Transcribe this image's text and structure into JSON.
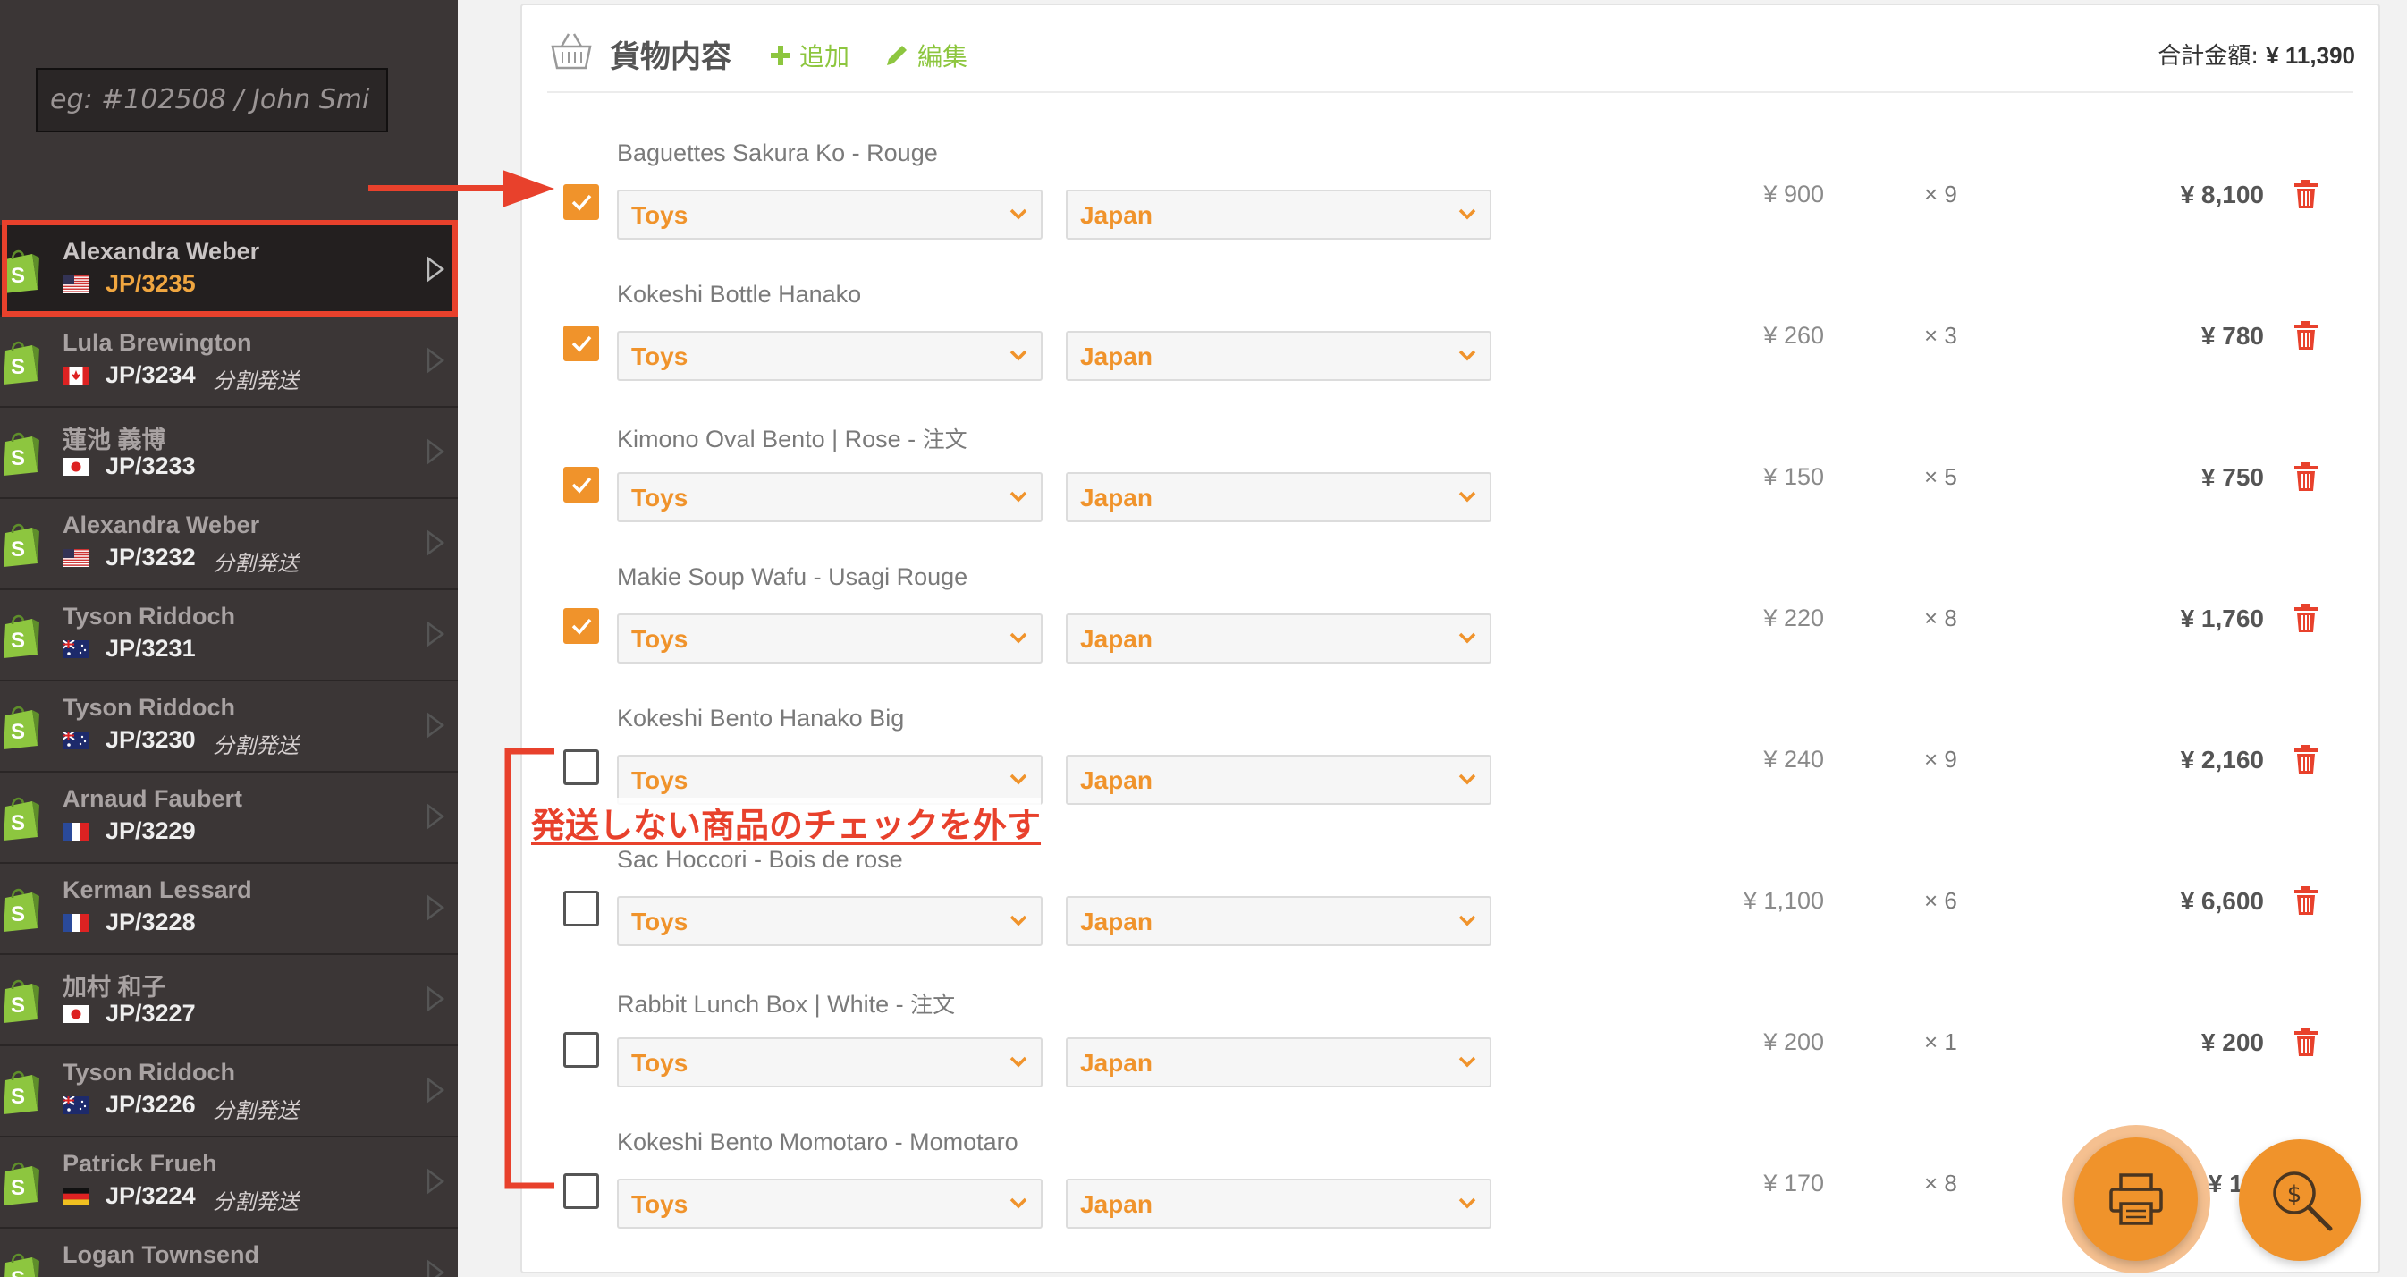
{
  "sidebar": {
    "search_placeholder": "eg: #102508 / John Smi",
    "orders": [
      {
        "name": "Alexandra Weber",
        "flag": "us",
        "id": "JP/3235",
        "tag": "",
        "active": true
      },
      {
        "name": "Lula Brewington",
        "flag": "ca",
        "id": "JP/3234",
        "tag": "分割発送",
        "active": false
      },
      {
        "name": "蓮池 義博",
        "flag": "jp",
        "id": "JP/3233",
        "tag": "",
        "active": false
      },
      {
        "name": "Alexandra Weber",
        "flag": "us",
        "id": "JP/3232",
        "tag": "分割発送",
        "active": false
      },
      {
        "name": "Tyson Riddoch",
        "flag": "au",
        "id": "JP/3231",
        "tag": "",
        "active": false
      },
      {
        "name": "Tyson Riddoch",
        "flag": "au",
        "id": "JP/3230",
        "tag": "分割発送",
        "active": false
      },
      {
        "name": "Arnaud Faubert",
        "flag": "fr",
        "id": "JP/3229",
        "tag": "",
        "active": false
      },
      {
        "name": "Kerman Lessard",
        "flag": "fr",
        "id": "JP/3228",
        "tag": "",
        "active": false
      },
      {
        "name": "加村 和子",
        "flag": "jp",
        "id": "JP/3227",
        "tag": "",
        "active": false
      },
      {
        "name": "Tyson Riddoch",
        "flag": "au",
        "id": "JP/3226",
        "tag": "分割発送",
        "active": false
      },
      {
        "name": "Patrick Frueh",
        "flag": "de",
        "id": "JP/3224",
        "tag": "分割発送",
        "active": false
      },
      {
        "name": "Logan Townsend",
        "flag": "",
        "id": "",
        "tag": "",
        "active": false
      }
    ]
  },
  "panel": {
    "title": "貨物内容",
    "add_label": "追加",
    "edit_label": "編集",
    "total_label": "合計金額:",
    "total_value": "¥ 11,390"
  },
  "items": [
    {
      "name": "Baguettes Sakura Ko - Rouge",
      "name_suffix": "",
      "checked": true,
      "category": "Toys",
      "origin": "Japan",
      "price": "¥ 900",
      "qty": "× 9",
      "subtotal": "¥ 8,100"
    },
    {
      "name": "Kokeshi Bottle Hanako",
      "name_suffix": "",
      "checked": true,
      "category": "Toys",
      "origin": "Japan",
      "price": "¥ 260",
      "qty": "× 3",
      "subtotal": "¥ 780"
    },
    {
      "name": "Kimono Oval Bento | Rose - ",
      "name_suffix": "注文",
      "checked": true,
      "category": "Toys",
      "origin": "Japan",
      "price": "¥ 150",
      "qty": "× 5",
      "subtotal": "¥ 750"
    },
    {
      "name": "Makie Soup Wafu - Usagi Rouge",
      "name_suffix": "",
      "checked": true,
      "category": "Toys",
      "origin": "Japan",
      "price": "¥ 220",
      "qty": "× 8",
      "subtotal": "¥ 1,760"
    },
    {
      "name": "Kokeshi Bento Hanako Big",
      "name_suffix": "",
      "checked": false,
      "category": "Toys",
      "origin": "Japan",
      "price": "¥ 240",
      "qty": "× 9",
      "subtotal": "¥ 2,160"
    },
    {
      "name": "Sac Hoccori - Bois de rose",
      "name_suffix": "",
      "checked": false,
      "category": "Toys",
      "origin": "Japan",
      "price": "¥ 1,100",
      "qty": "× 6",
      "subtotal": "¥ 6,600"
    },
    {
      "name": "Rabbit Lunch Box | White - ",
      "name_suffix": "注文",
      "checked": false,
      "category": "Toys",
      "origin": "Japan",
      "price": "¥ 200",
      "qty": "× 1",
      "subtotal": "¥ 200"
    },
    {
      "name": "Kokeshi Bento Momotaro - Momotaro",
      "name_suffix": "",
      "checked": false,
      "category": "Toys",
      "origin": "Japan",
      "price": "¥ 170",
      "qty": "× 8",
      "subtotal": "¥ 1,3"
    }
  ],
  "annotation": {
    "text": "発送しない商品のチェックを外す"
  },
  "colors": {
    "accent": "#f0932b",
    "annotation": "#e8412c",
    "add_green": "#8dc63f",
    "sidebar_bg": "#3b3636",
    "trash_red": "#e8412c"
  }
}
